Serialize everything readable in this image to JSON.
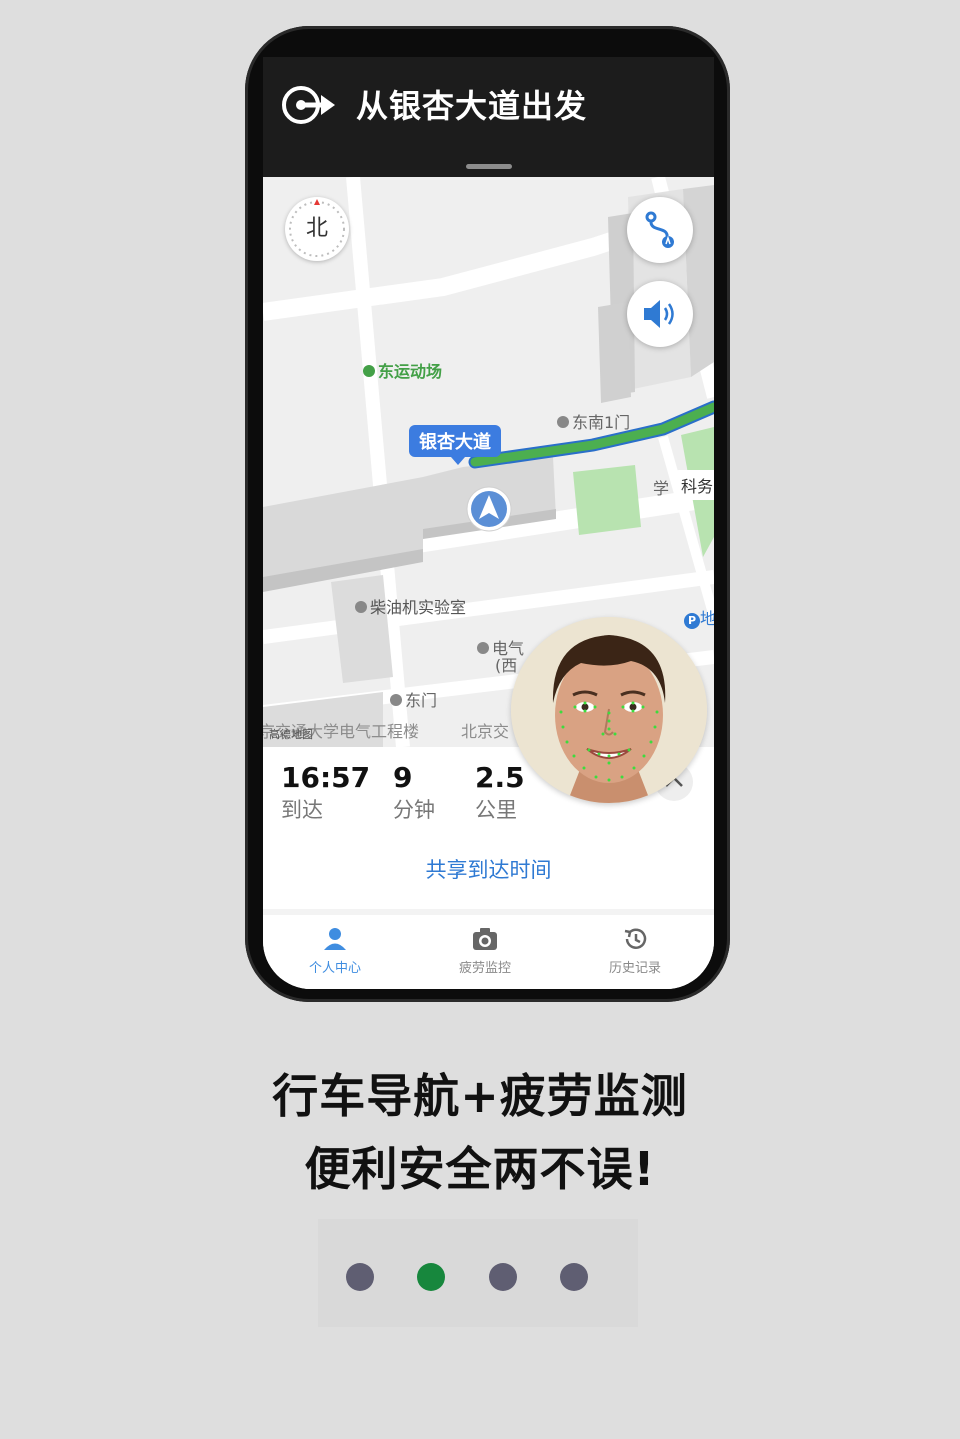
{
  "nav_header": {
    "title": "从银杏大道出发"
  },
  "map": {
    "compass_label": "北",
    "road_name": "银杏大道",
    "labels": {
      "stadium": "东运动场",
      "southeast_gate": "东南1门",
      "science": "科务",
      "xue": "学",
      "diesel_lab": "柴油机实验室",
      "electrical": "电气",
      "electrical_west": "(西",
      "east_gate": "东门",
      "school_building": "京交通大学电气工程楼",
      "beijing_jiao": "北京交",
      "parking": "地",
      "watermark": "高德地图"
    }
  },
  "route_info": {
    "arrival_time": "16:57",
    "arrival_label": "到达",
    "minutes": "9",
    "minutes_label": "分钟",
    "distance": "2.5",
    "distance_label": "公里",
    "share_label": "共享到达时间"
  },
  "tabs": [
    {
      "label": "个人中心",
      "icon": "person-icon",
      "active": true
    },
    {
      "label": "疲劳监控",
      "icon": "camera-icon",
      "active": false
    },
    {
      "label": "历史记录",
      "icon": "history-icon",
      "active": false
    }
  ],
  "caption": {
    "line1": "行车导航+疲劳监测",
    "line2": "便利安全两不误!"
  },
  "pager": {
    "total": 4,
    "active_index": 1
  },
  "colors": {
    "accent": "#3c7ce0",
    "route": "#4caf50",
    "pager_active": "#17873d",
    "pager_inactive": "#5f5e72"
  }
}
